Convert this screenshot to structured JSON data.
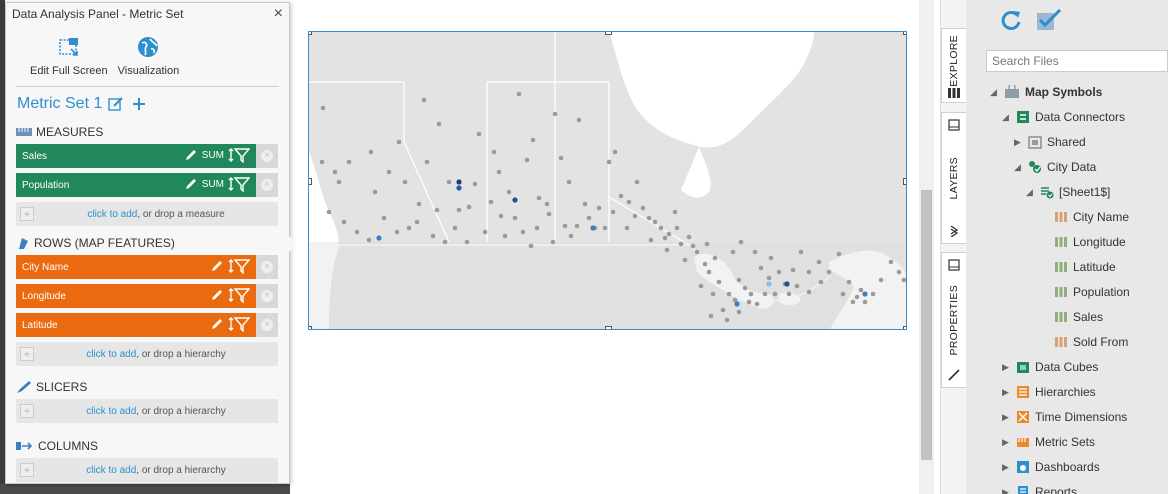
{
  "panel": {
    "title": "Data Analysis Panel - Metric Set",
    "close_label": "×",
    "tools": [
      {
        "label": "Edit Full Screen"
      },
      {
        "label": "Visualization"
      }
    ],
    "metric_set_title": "Metric Set 1",
    "sections": {
      "measures": "MEASURES",
      "rows": "ROWS (MAP FEATURES)",
      "slicers": "SLICERS",
      "columns": "COLUMNS"
    },
    "measures": [
      {
        "label": "Sales",
        "agg": "SUM"
      },
      {
        "label": "Population",
        "agg": "SUM"
      }
    ],
    "rows": [
      {
        "label": "City Name"
      },
      {
        "label": "Longitude"
      },
      {
        "label": "Latitude"
      }
    ],
    "add_link": "click to add",
    "add_measure_hint": ", or drop a measure",
    "add_hierarchy_hint": ", or drop a hierarchy"
  },
  "side_tabs": {
    "explore": "EXPLORE",
    "layers": "LAYERS",
    "properties": "PROPERTIES"
  },
  "explorer": {
    "search_placeholder": "Search Files",
    "tree": [
      {
        "label": "Map Symbols",
        "bold": true
      },
      {
        "label": "Data Connectors"
      },
      {
        "label": "Shared"
      },
      {
        "label": "City Data"
      },
      {
        "label": "[Sheet1$]"
      },
      {
        "label": "City Name"
      },
      {
        "label": "Longitude"
      },
      {
        "label": "Latitude"
      },
      {
        "label": "Population"
      },
      {
        "label": "Sales"
      },
      {
        "label": "Sold From"
      },
      {
        "label": "Data Cubes"
      },
      {
        "label": "Hierarchies"
      },
      {
        "label": "Time Dimensions"
      },
      {
        "label": "Metric Sets"
      },
      {
        "label": "Dashboards"
      },
      {
        "label": "Reports"
      }
    ]
  },
  "colors": {
    "accent_blue": "#2e8fce",
    "measure_green": "#20885a",
    "row_orange": "#ea6a10"
  }
}
